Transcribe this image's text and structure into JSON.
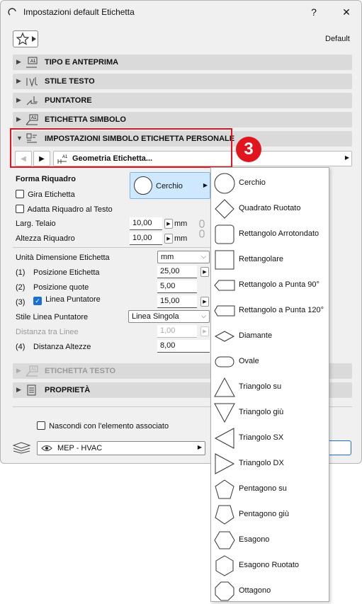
{
  "window": {
    "title": "Impostazioni default Etichetta",
    "help": "?",
    "close": "✕"
  },
  "favorites": {
    "label": "Default"
  },
  "panels": {
    "tipo": "TIPO E ANTEPRIMA",
    "stile": "STILE TESTO",
    "puntatore": "PUNTATORE",
    "simbolo": "ETICHETTA SIMBOLO",
    "personale": "IMPOSTAZIONI SIMBOLO ETICHETTA PERSONALE",
    "testo": "ETICHETTA TESTO",
    "proprieta": "PROPRIETÀ"
  },
  "geometry_tab": {
    "label": "Geometria Etichetta..."
  },
  "badge": "3",
  "form": {
    "forma_label": "Forma Riquadro",
    "shape_selected": "Cerchio",
    "gira": "Gira Etichetta",
    "adatta": "Adatta Riquadro al Testo",
    "larg_label": "Larg. Telaio",
    "larg_value": "10,00",
    "altezza_label": "Altezza Riquadro",
    "altezza_value": "10,00",
    "unit_mm": "mm",
    "unita_label": "Unità Dimensione Etichetta",
    "unita_value": "mm",
    "n1": "(1)",
    "pos_etichetta_label": "Posizione Etichetta",
    "pos_etichetta_value": "25,00",
    "n2": "(2)",
    "pos_quote_label": "Posizione quote",
    "pos_quote_value": "5,00",
    "n3": "(3)",
    "linea_label": "Linea Puntatore",
    "linea_value": "15,00",
    "stile_label": "Stile Linea Puntatore",
    "stile_value": "Linea Singola",
    "distanza_linee_label": "Distanza tra Linee",
    "distanza_linee_value": "1,00",
    "n4": "(4)",
    "distanza_alt_label": "Distanza Altezze",
    "distanza_alt_value": "8,00"
  },
  "footer": {
    "nascondi": "Nascondi con l'elemento associato",
    "layer": "MEP - HVAC"
  },
  "shape_menu": [
    "Cerchio",
    "Quadrato Ruotato",
    "Rettangolo Arrotondato",
    "Rettangolare",
    "Rettangolo a Punta 90°",
    "Rettangolo a Punta 120°",
    "Diamante",
    "Ovale",
    "Triangolo su",
    "Triangolo giù",
    "Triangolo SX",
    "Triangolo DX",
    "Pentagono su",
    "Pentagono giù",
    "Esagono",
    "Esagono Ruotato",
    "Ottagono"
  ],
  "colors": {
    "accent": "#e0151d",
    "selected": "#cde8ff",
    "checkbox": "#1a6fd1"
  }
}
